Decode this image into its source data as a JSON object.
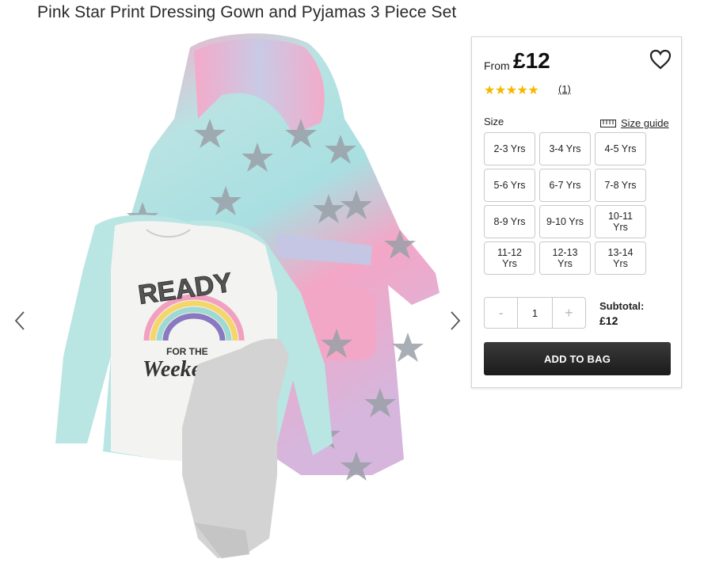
{
  "product": {
    "title": "Pink Star Print Dressing Gown and Pyjamas 3 Piece Set",
    "image_text": {
      "line1": "READY",
      "line2": "FOR THE",
      "line3": "Weekend"
    }
  },
  "gallery": {
    "prev_icon": "chevron-left-icon",
    "next_icon": "chevron-right-icon"
  },
  "pricing": {
    "from_label": "From",
    "price": "£12"
  },
  "reviews": {
    "rating": 5,
    "stars": "★★★★★",
    "count": "(1)"
  },
  "size": {
    "label": "Size",
    "guide_label": "Size guide",
    "options": [
      "2-3 Yrs",
      "3-4 Yrs",
      "4-5 Yrs",
      "5-6 Yrs",
      "6-7 Yrs",
      "7-8 Yrs",
      "8-9 Yrs",
      "9-10 Yrs",
      "10-11 Yrs",
      "11-12 Yrs",
      "12-13 Yrs",
      "13-14 Yrs"
    ]
  },
  "quantity": {
    "minus": "-",
    "value": "1",
    "plus": "+"
  },
  "subtotal": {
    "label": "Subtotal:",
    "value": "£12"
  },
  "cart": {
    "add_label": "ADD TO BAG"
  },
  "colors": {
    "accent_star": "#f5b800",
    "button_bg": "#1f1f1f"
  }
}
